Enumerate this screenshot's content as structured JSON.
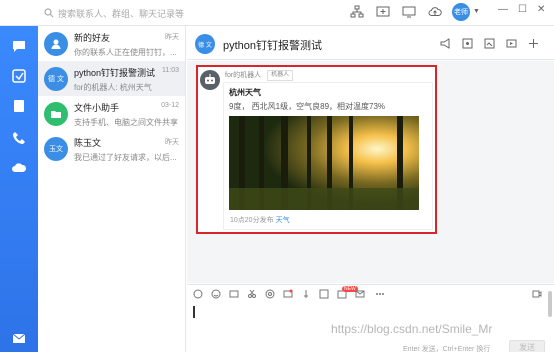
{
  "search": {
    "placeholder": "搜索联系人、群组、聊天记录等"
  },
  "user": {
    "avatar_text": "老师"
  },
  "conversations": [
    {
      "name": "新的好友",
      "preview": "你的联系人正在使用钉钉，...",
      "time": "昨天",
      "avatar_color": "#3a8ee6",
      "avatar_text": ""
    },
    {
      "name": "python钉钉报警测试",
      "preview": "for的机器人: 杭州天气",
      "time": "11:03",
      "avatar_color": "#3a8ee6",
      "avatar_text": "德 文"
    },
    {
      "name": "文件小助手",
      "preview": "支持手机、电脑之间文件共享",
      "time": "03-12",
      "avatar_color": "#2fbd6f",
      "avatar_text": ""
    },
    {
      "name": "陈玉文",
      "preview": "我已通过了好友请求，以后...",
      "time": "昨天",
      "avatar_color": "#3a8ee6",
      "avatar_text": "玉文"
    }
  ],
  "chat": {
    "title": "python钉钉报警测试",
    "avatar_text": "德 文",
    "message": {
      "sender": "for的机器人",
      "sender_tag": "机器人",
      "card_title": "杭州天气",
      "card_desc": "9度， 西北风1级，空气良89，相对温度73%",
      "footer_time": "10点20分发布",
      "footer_link": "天气"
    },
    "toolbar_badge": "NEW",
    "hint": "Enter 发送，Ctrl+Enter 换行",
    "send_label": "发送"
  },
  "watermark": "https://blog.csdn.net/Smile_Mr",
  "colors": {
    "accent": "#3a8ee6",
    "rail": "#2e73e8",
    "highlight_border": "#d9252a"
  }
}
